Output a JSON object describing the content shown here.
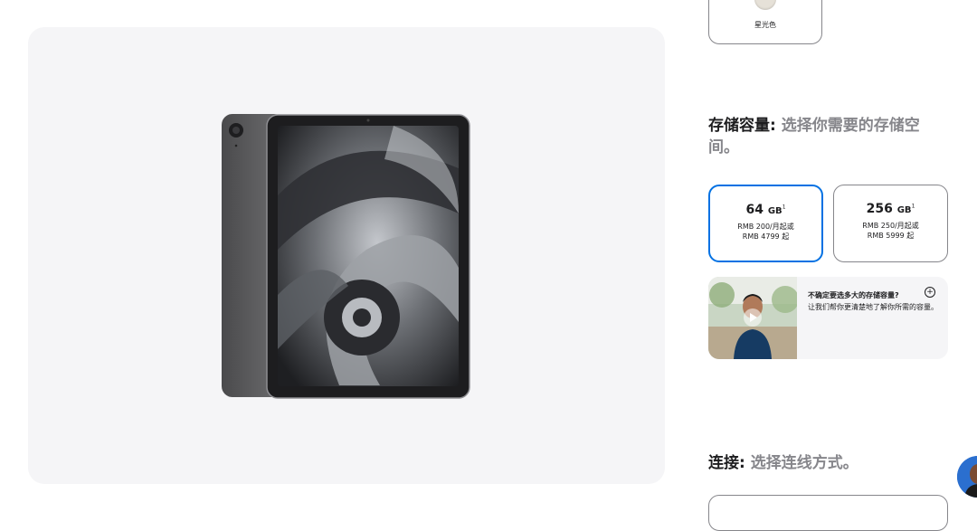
{
  "color_option": {
    "label": "星光色",
    "swatch_color": "#e6e1d8"
  },
  "storage": {
    "title_bold": "存储容量",
    "title_sep": ":",
    "title_rest": " 选择你需要的存储空间。",
    "options": [
      {
        "size": "64",
        "unit": "GB",
        "footnote": "1",
        "monthly": "RMB 200/月起或",
        "price": "RMB 4799 起",
        "selected": true
      },
      {
        "size": "256",
        "unit": "GB",
        "footnote": "1",
        "monthly": "RMB 250/月起或",
        "price": "RMB 5999 起",
        "selected": false
      }
    ]
  },
  "help": {
    "heading": "不确定要选多大的存储容量?",
    "body": "让我们帮你更清楚地了解你所需的容量。",
    "plus": "+"
  },
  "connection": {
    "title_bold": "连接",
    "title_sep": ":",
    "title_rest": " 选择连线方式。"
  },
  "colors": {
    "accent": "#0071e3",
    "panel_bg": "#f5f5f7"
  },
  "icons": [
    "play-icon",
    "plus-circle-icon"
  ]
}
